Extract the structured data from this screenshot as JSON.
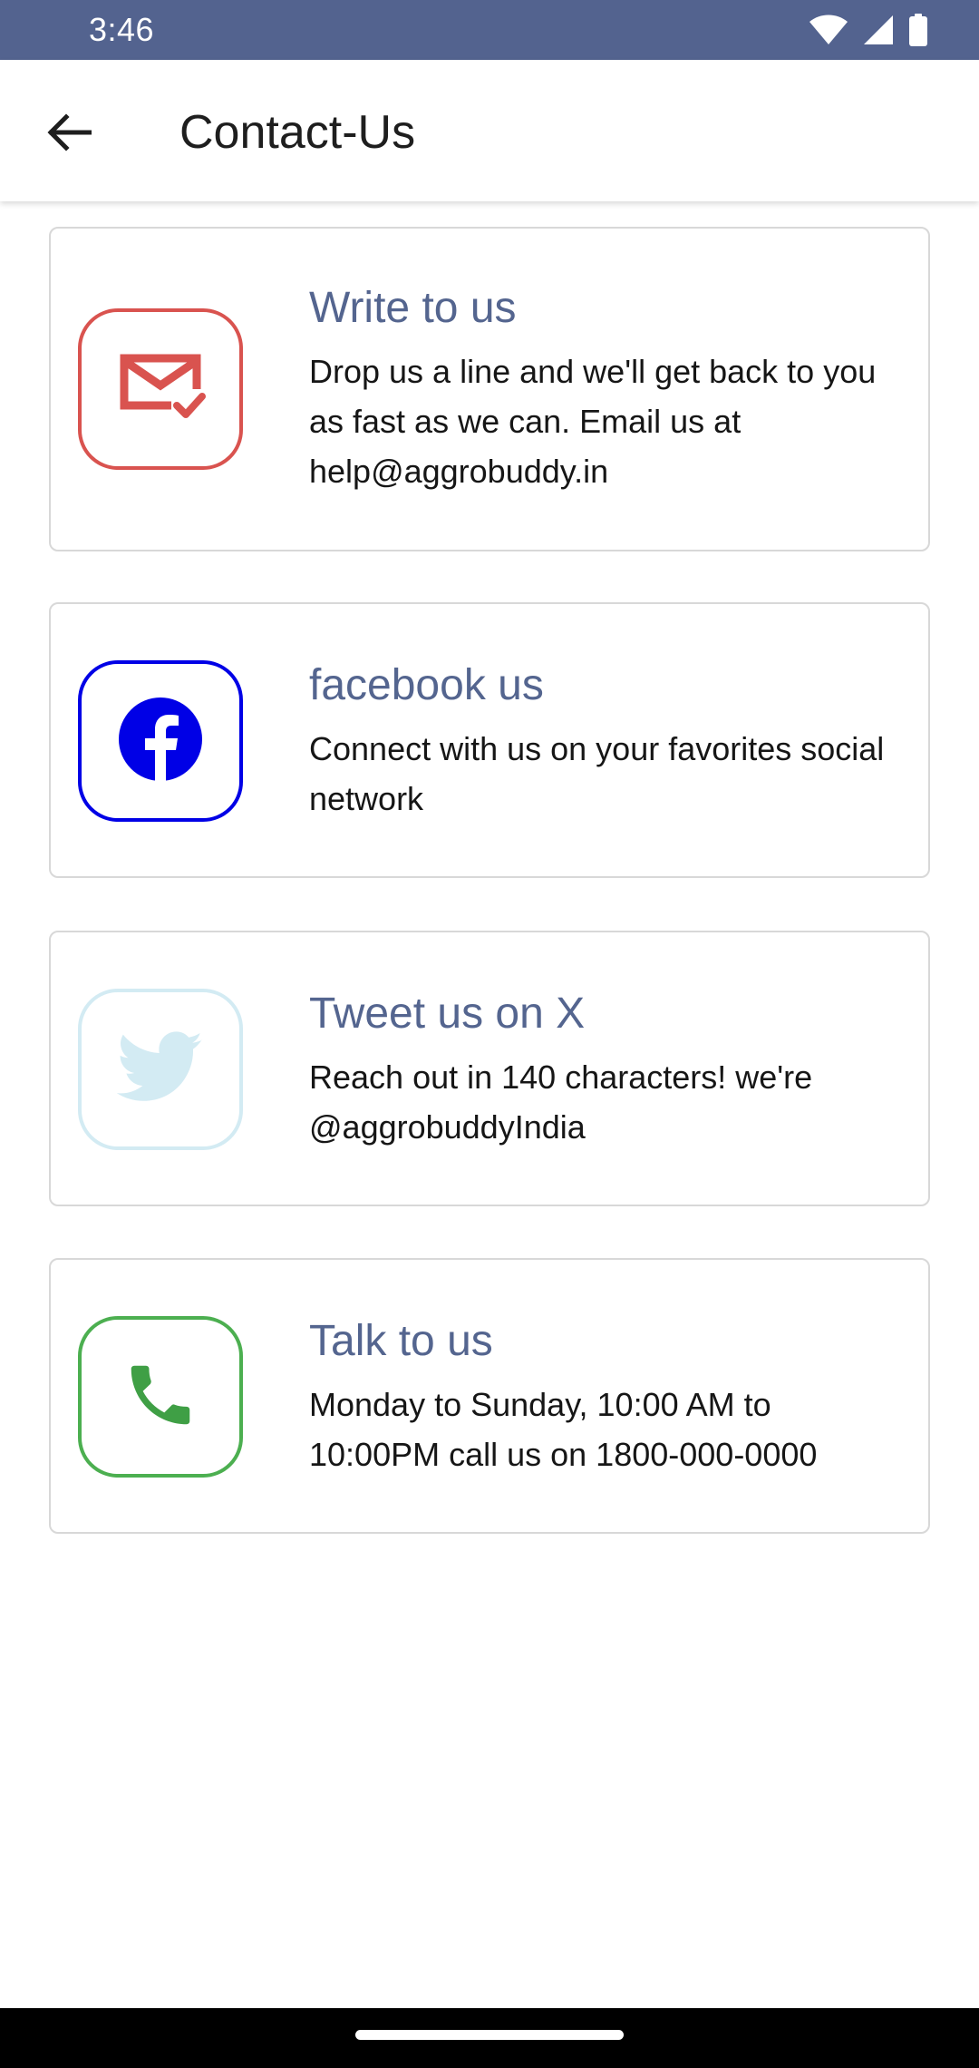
{
  "status_bar": {
    "time": "3:46",
    "icons": [
      "wifi-icon",
      "signal-icon",
      "battery-icon"
    ]
  },
  "app_bar": {
    "back_icon": "arrow-back-icon",
    "title": "Contact-Us"
  },
  "cards": [
    {
      "icon": "email-check-icon",
      "icon_color": "#d9534f",
      "title": "Write to us",
      "description": "Drop us a line and we'll get back to you as fast as we can. Email us at help@aggrobuddy.in"
    },
    {
      "icon": "facebook-icon",
      "icon_color": "#0000e6",
      "title": "facebook us",
      "description": "Connect with us on your favorites social network"
    },
    {
      "icon": "twitter-icon",
      "icon_color": "#d3ebf3",
      "title": "Tweet us on X",
      "description": "Reach out in 140 characters! we're @aggrobuddyIndia"
    },
    {
      "icon": "phone-icon",
      "icon_color": "#4caf50",
      "title": "Talk to us",
      "description": "Monday to Sunday, 10:00 AM to 10:00PM call us on 1800-000-0000"
    }
  ],
  "colors": {
    "status_bar": "#53638f",
    "title_accent": "#54658f",
    "card_border": "#d8d8d8"
  }
}
